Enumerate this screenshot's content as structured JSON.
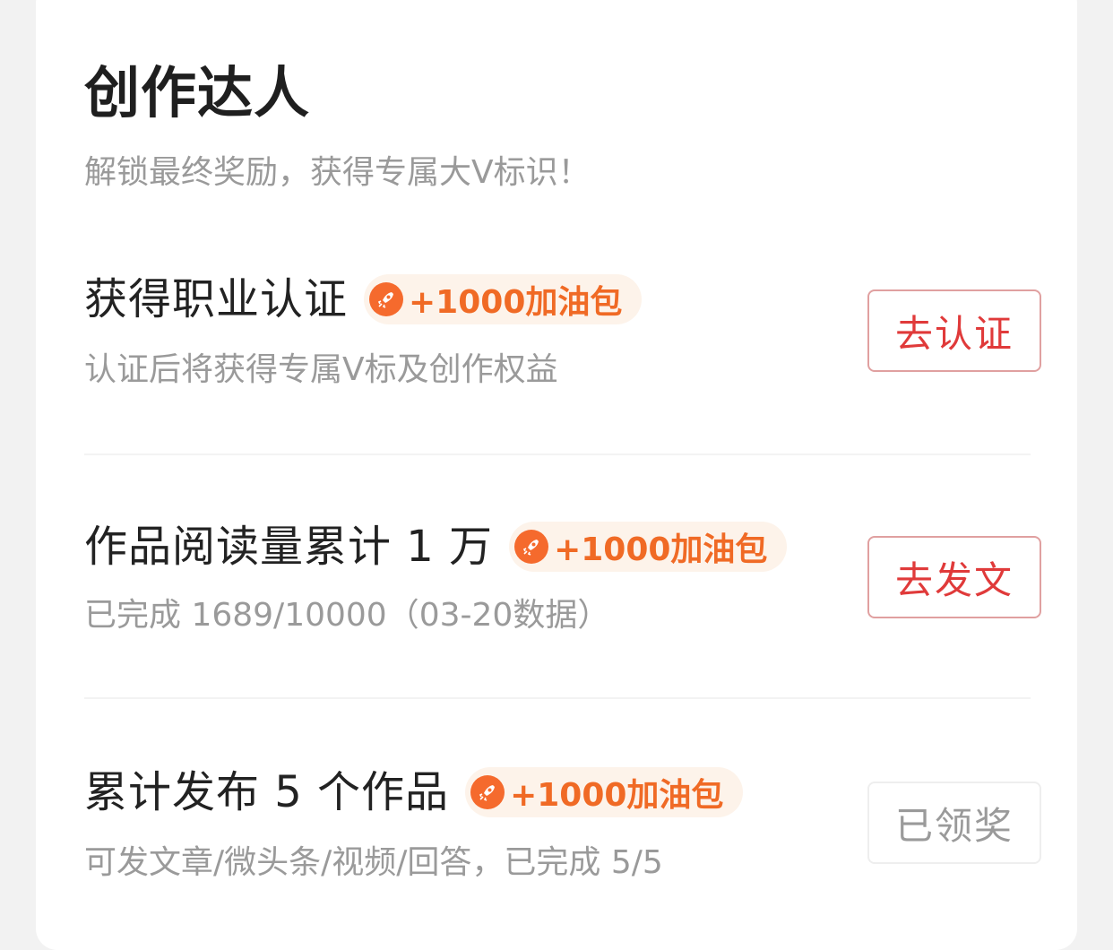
{
  "header": {
    "title": "创作达人",
    "subtitle": "解锁最终奖励，获得专属大V标识！"
  },
  "tasks": [
    {
      "title": "获得职业认证",
      "reward": "+1000加油包",
      "description": "认证后将获得专属V标及创作权益",
      "button": "去认证",
      "state": "active"
    },
    {
      "title": "作品阅读量累计 1 万",
      "reward": "+1000加油包",
      "description": "已完成 1689/10000（03-20数据）",
      "button": "去发文",
      "state": "active"
    },
    {
      "title": "累计发布 5 个作品",
      "reward": "+1000加油包",
      "description": "可发文章/微头条/视频/回答，已完成 5/5",
      "button": "已领奖",
      "state": "claimed"
    }
  ],
  "colors": {
    "accent_red": "#e03a3a",
    "reward_orange": "#f06a25",
    "reward_bg": "#fdf3ea",
    "muted_text": "#9a9a9a"
  },
  "icons": {
    "reward": "rocket-icon"
  }
}
